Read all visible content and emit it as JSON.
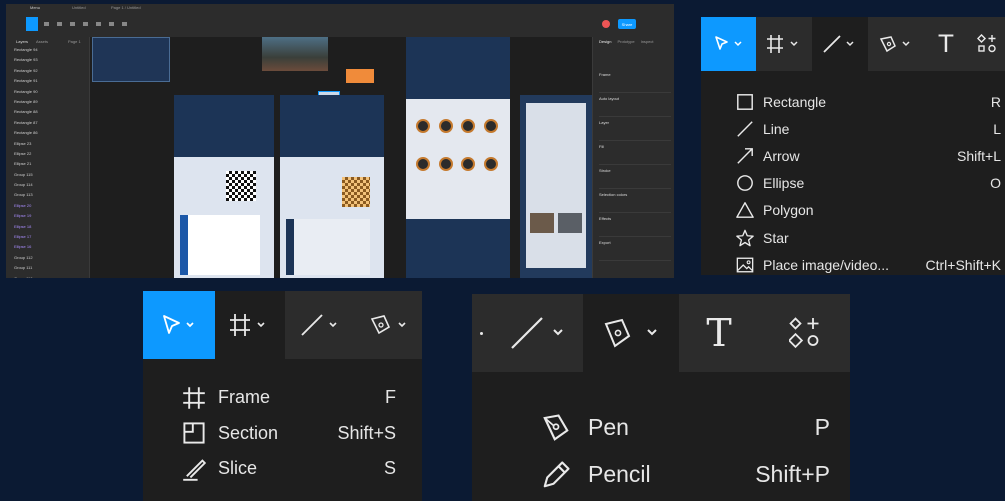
{
  "figma_window": {
    "tabs": [
      "Menu",
      "Untitled",
      "Page 1 / Untitled"
    ],
    "share_label": "Share",
    "layers_tab": "Layers",
    "assets_tab": "Assets",
    "page_label": "Page 1",
    "layers": [
      "Rectangle 94",
      "Rectangle 93",
      "Rectangle 92",
      "Rectangle 91",
      "Rectangle 90",
      "Rectangle 89",
      "Rectangle 88",
      "Rectangle 87",
      "Rectangle 86",
      "Ellipse 23",
      "Ellipse 22",
      "Ellipse 21",
      "Group 115",
      "Group 114",
      "Group 113",
      "Ellipse 20",
      "Ellipse 19",
      "Ellipse 18",
      "Ellipse 17",
      "Ellipse 16",
      "Group 112",
      "Group 111",
      "Group 110"
    ],
    "right_tabs": [
      "Design",
      "Prototype",
      "Inspect"
    ],
    "right_sections": [
      "Frame",
      "Auto layout",
      "Layer",
      "Fill",
      "Stroke",
      "Selection colors",
      "Effects",
      "Export"
    ]
  },
  "toolbar_top_right": {
    "text_icon": "T",
    "chevron": "⌄"
  },
  "shapes_menu": {
    "items": [
      {
        "label": "Rectangle",
        "shortcut": "R",
        "icon": "rectangle-icon"
      },
      {
        "label": "Line",
        "shortcut": "L",
        "icon": "line-icon"
      },
      {
        "label": "Arrow",
        "shortcut": "Shift+L",
        "icon": "arrow-icon"
      },
      {
        "label": "Ellipse",
        "shortcut": "O",
        "icon": "ellipse-icon"
      },
      {
        "label": "Polygon",
        "shortcut": "",
        "icon": "polygon-icon"
      },
      {
        "label": "Star",
        "shortcut": "",
        "icon": "star-icon"
      },
      {
        "label": "Place image/video...",
        "shortcut": "Ctrl+Shift+K",
        "icon": "image-icon"
      }
    ]
  },
  "frame_menu": {
    "items": [
      {
        "label": "Frame",
        "shortcut": "F",
        "icon": "frame-icon"
      },
      {
        "label": "Section",
        "shortcut": "Shift+S",
        "icon": "section-icon"
      },
      {
        "label": "Slice",
        "shortcut": "S",
        "icon": "slice-icon"
      }
    ]
  },
  "pen_menu": {
    "items": [
      {
        "label": "Pen",
        "shortcut": "P",
        "icon": "pen-icon"
      },
      {
        "label": "Pencil",
        "shortcut": "Shift+P",
        "icon": "pencil-icon"
      }
    ]
  },
  "colors": {
    "accent": "#0d99ff",
    "toolbar": "#2c2c2c",
    "menu": "#1e1e1e",
    "background": "#0b1a33"
  }
}
